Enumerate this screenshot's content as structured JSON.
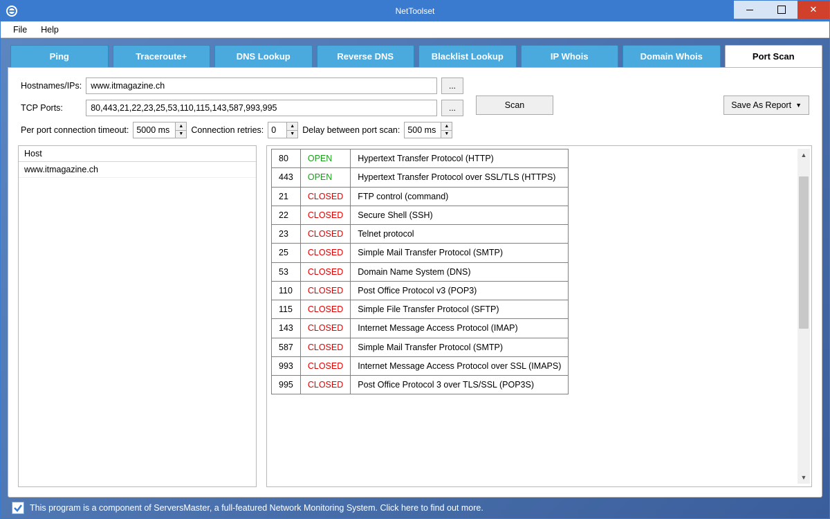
{
  "window": {
    "title": "NetToolset"
  },
  "menu": {
    "file": "File",
    "help": "Help"
  },
  "tabs": [
    {
      "label": "Ping"
    },
    {
      "label": "Traceroute+"
    },
    {
      "label": "DNS Lookup"
    },
    {
      "label": "Reverse DNS"
    },
    {
      "label": "Blacklist Lookup"
    },
    {
      "label": "IP Whois"
    },
    {
      "label": "Domain Whois"
    },
    {
      "label": "Port Scan"
    }
  ],
  "form": {
    "hostnames_label": "Hostnames/IPs:",
    "hostnames_value": "www.itmagazine.ch",
    "tcp_ports_label": "TCP Ports:",
    "tcp_ports_value": "80,443,21,22,23,25,53,110,115,143,587,993,995",
    "timeout_label": "Per port connection timeout:",
    "timeout_value": "5000 ms",
    "retries_label": "Connection retries:",
    "retries_value": "0",
    "delay_label": "Delay between port scan:",
    "delay_value": "500 ms",
    "scan_button": "Scan",
    "save_button": "Save As Report",
    "dots": "..."
  },
  "hosts": {
    "header": "Host",
    "items": [
      "www.itmagazine.ch"
    ]
  },
  "results": [
    {
      "port": "80",
      "status": "OPEN",
      "desc": "Hypertext Transfer Protocol (HTTP)"
    },
    {
      "port": "443",
      "status": "OPEN",
      "desc": "Hypertext Transfer Protocol over SSL/TLS (HTTPS)"
    },
    {
      "port": "21",
      "status": "CLOSED",
      "desc": "FTP control (command)"
    },
    {
      "port": "22",
      "status": "CLOSED",
      "desc": "Secure Shell (SSH)"
    },
    {
      "port": "23",
      "status": "CLOSED",
      "desc": "Telnet protocol"
    },
    {
      "port": "25",
      "status": "CLOSED",
      "desc": "Simple Mail Transfer Protocol (SMTP)"
    },
    {
      "port": "53",
      "status": "CLOSED",
      "desc": "Domain Name System (DNS)"
    },
    {
      "port": "110",
      "status": "CLOSED",
      "desc": "Post Office Protocol v3 (POP3)"
    },
    {
      "port": "115",
      "status": "CLOSED",
      "desc": "Simple File Transfer Protocol (SFTP)"
    },
    {
      "port": "143",
      "status": "CLOSED",
      "desc": "Internet Message Access Protocol (IMAP)"
    },
    {
      "port": "587",
      "status": "CLOSED",
      "desc": "Simple Mail Transfer Protocol (SMTP)"
    },
    {
      "port": "993",
      "status": "CLOSED",
      "desc": "Internet Message Access Protocol over SSL (IMAPS)"
    },
    {
      "port": "995",
      "status": "CLOSED",
      "desc": "Post Office Protocol 3 over TLS/SSL (POP3S)"
    }
  ],
  "footer": {
    "text": "This program is a component of ServersMaster, a full-featured Network Monitoring System. Click here to find out more."
  }
}
